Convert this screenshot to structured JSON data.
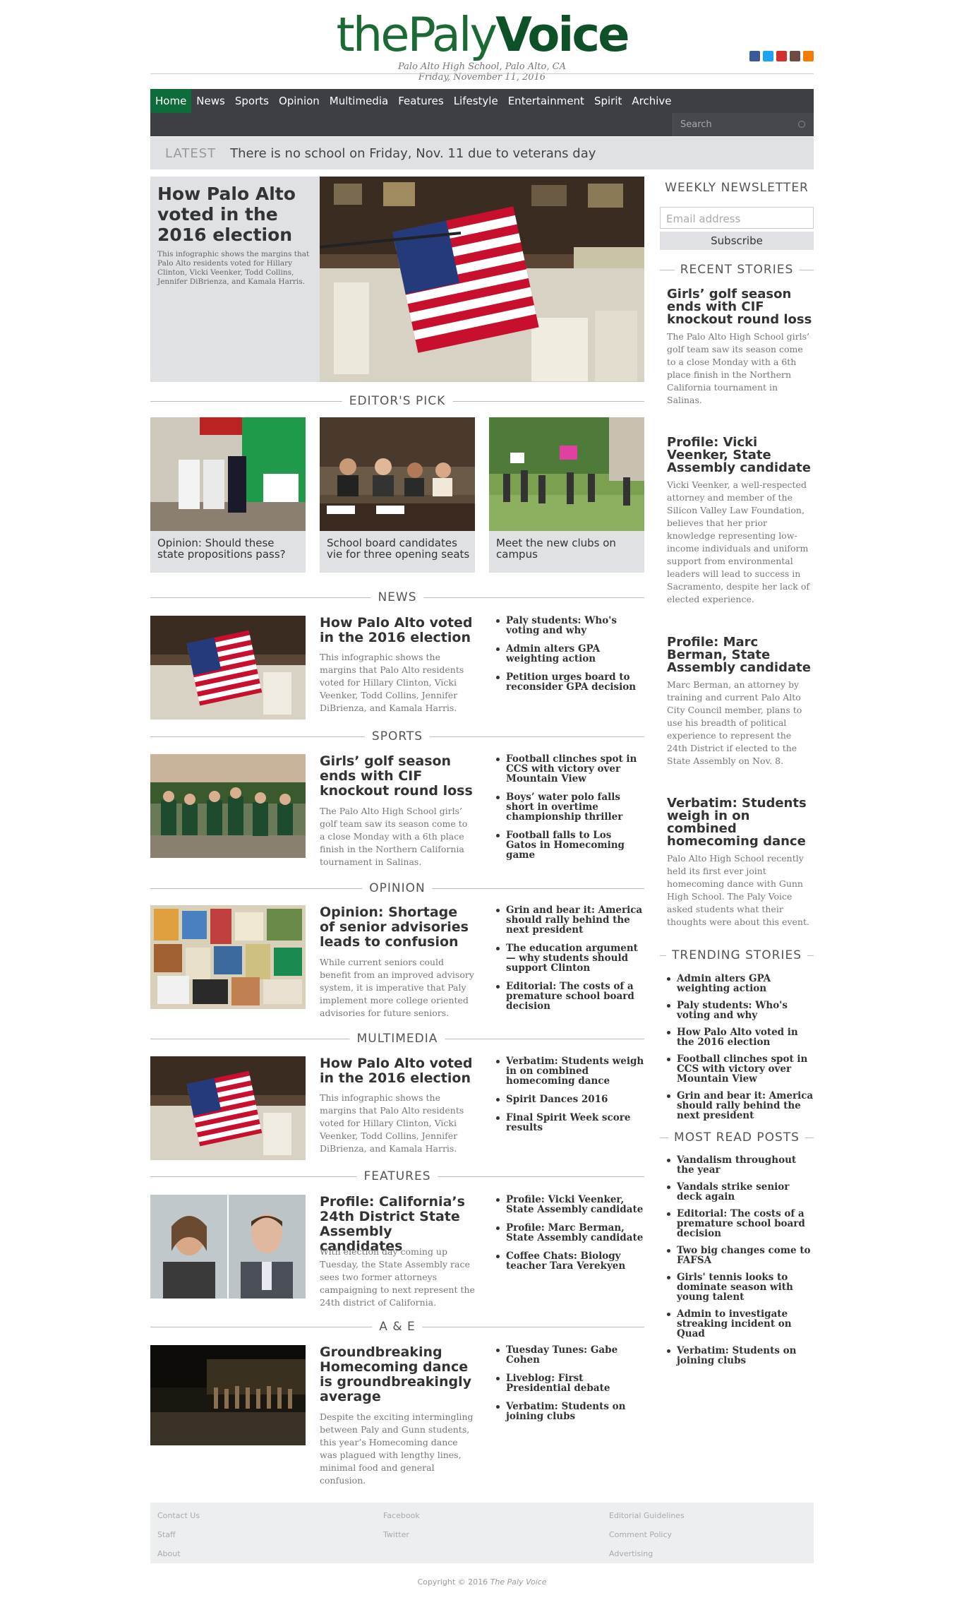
{
  "brand": {
    "logo_pre": "the",
    "logo_mid": "Paly",
    "logo_bold": "Voice",
    "tagline": "Palo Alto High School, Palo Alto, CA",
    "date": "Friday, November 11, 2016",
    "accent": "#0e6b3a"
  },
  "social": [
    "facebook-icon",
    "twitter-icon",
    "youtube-icon",
    "instagram-icon",
    "rss-icon"
  ],
  "nav": {
    "items": [
      "Home",
      "News",
      "Sports",
      "Opinion",
      "Multimedia",
      "Features",
      "Lifestyle",
      "Entertainment",
      "Spirit",
      "Archive"
    ],
    "search_placeholder": "Search"
  },
  "latest": {
    "label": "LATEST",
    "text": "There is no school on Friday, Nov. 11 due to veterans day"
  },
  "hero": {
    "title": "How Palo Alto voted in the 2016 election",
    "summary": "This infographic shows the margins that Palo Alto residents voted for Hillary Clinton, Vicki Veenker, Todd Collins, Jennifer DiBrienza, and Kamala Harris."
  },
  "editors_pick": {
    "heading": "EDITOR'S PICK",
    "items": [
      "Opinion: Should these state propositions pass?",
      "School board candidates vie for three opening seats",
      "Meet the new clubs on campus"
    ]
  },
  "sections": [
    {
      "heading": "NEWS",
      "title": "How Palo Alto voted in the 2016 election",
      "summary": "This infographic shows the margins that Palo Alto residents voted for Hillary Clinton, Vicki Veenker, Todd Collins, Jennifer DiBrienza, and Kamala Harris.",
      "links": [
        "Paly students: Who's voting and why",
        "Admin alters GPA weighting action",
        "Petition urges board to reconsider GPA decision"
      ]
    },
    {
      "heading": "SPORTS",
      "title": "Girls’ golf season ends with CIF knockout round loss",
      "summary": "The Palo Alto High School girls’ golf team saw its season come to a close Monday with a 6th place finish in the Northern California tournament in Salinas.",
      "links": [
        "Football clinches spot in CCS with victory over Mountain View",
        "Boys’ water polo falls short in overtime championship thriller",
        "Football falls to Los Gatos in Homecoming game"
      ]
    },
    {
      "heading": "OPINION",
      "title": "Opinion: Shortage of senior advisories leads to confusion",
      "summary": "While current seniors could benefit from an improved advisory system, it is imperative that Paly implement more college oriented advisories for future seniors.",
      "links": [
        "Grin and bear it: America should rally behind the next president",
        "The education argument — why students should support Clinton",
        "Editorial: The costs of a premature school board decision"
      ]
    },
    {
      "heading": "MULTIMEDIA",
      "title": "How Palo Alto voted in the 2016 election",
      "summary": "This infographic shows the margins that Palo Alto residents voted for Hillary Clinton, Vicki Veenker, Todd Collins, Jennifer DiBrienza, and Kamala Harris.",
      "links": [
        "Verbatim: Students weigh in on combined homecoming dance",
        "Spirit Dances 2016",
        "Final Spirit Week score results"
      ]
    },
    {
      "heading": "FEATURES",
      "title": "Profile: California’s 24th District State Assembly candidates",
      "summary": "With election day coming up Tuesday, the State Assembly race sees two former attorneys campaigning to next represent the 24th district of California.",
      "links": [
        "Profile: Vicki Veenker, State Assembly candidate",
        "Profile: Marc Berman, State Assembly candidate",
        "Coffee Chats: Biology teacher Tara Verekyen"
      ]
    },
    {
      "heading": "A & E",
      "title": "Groundbreaking Homecoming dance is groundbreakingly average",
      "summary": "Despite the exciting intermingling between Paly and Gunn students, this year’s Homecoming dance was plagued with lengthy lines, minimal food and general confusion.",
      "links": [
        "Tuesday Tunes: Gabe Cohen",
        "Liveblog: First Presidential debate",
        "Verbatim: Students on joining clubs"
      ]
    }
  ],
  "sidebar": {
    "newsletter_heading": "WEEKLY NEWSLETTER",
    "email_placeholder": "Email address",
    "subscribe": "Subscribe",
    "recent_heading": "RECENT STORIES",
    "recent": [
      {
        "title": "Girls’ golf season ends with CIF knockout round loss",
        "summary": "The Palo Alto High School girls’ golf team saw its season come to a close Monday with a 6th place finish in the Northern California tournament in Salinas."
      },
      {
        "title": "Profile: Vicki Veenker, State Assembly candidate",
        "summary": "Vicki Veenker, a well-respected attorney and member of the Silicon Valley Law Foundation, believes that her prior knowledge representing low-income individuals and uniform support from environmental leaders will lead to success in Sacramento, despite her lack of elected experience."
      },
      {
        "title": "Profile: Marc Berman, State Assembly candidate",
        "summary": "Marc Berman, an attorney by training and current Palo Alto City Council member, plans to use his breadth of political experience to represent the 24th District if elected to the State Assembly on Nov. 8."
      },
      {
        "title": "Verbatim: Students weigh in on combined homecoming dance",
        "summary": "Palo Alto High School recently held its first ever joint homecoming dance with Gunn High School. The Paly Voice asked students what their thoughts were about this event."
      }
    ],
    "trending_heading": "TRENDING STORIES",
    "trending": [
      "Admin alters GPA weighting action",
      "Paly students: Who's voting and why",
      "How Palo Alto voted in the 2016 election",
      "Football clinches spot in CCS with victory over Mountain View",
      "Grin and bear it: America should rally behind the next president"
    ],
    "mostread_heading": "MOST READ POSTS",
    "mostread": [
      "Vandalism throughout the year",
      "Vandals strike senior deck again",
      "Editorial: The costs of a premature school board decision",
      "Two big changes come to FAFSA",
      "Girls' tennis looks to dominate season with young talent",
      "Admin to investigate streaking incident on Quad",
      "Verbatim: Students on joining clubs"
    ]
  },
  "footer": {
    "col1": [
      "Contact Us",
      "Staff",
      "About"
    ],
    "col2": [
      "Facebook",
      "Twitter"
    ],
    "col3": [
      "Editorial Guidelines",
      "Comment Policy",
      "Advertising"
    ],
    "copyright": "Copyright © 2016",
    "copyright_name": "The Paly Voice"
  }
}
